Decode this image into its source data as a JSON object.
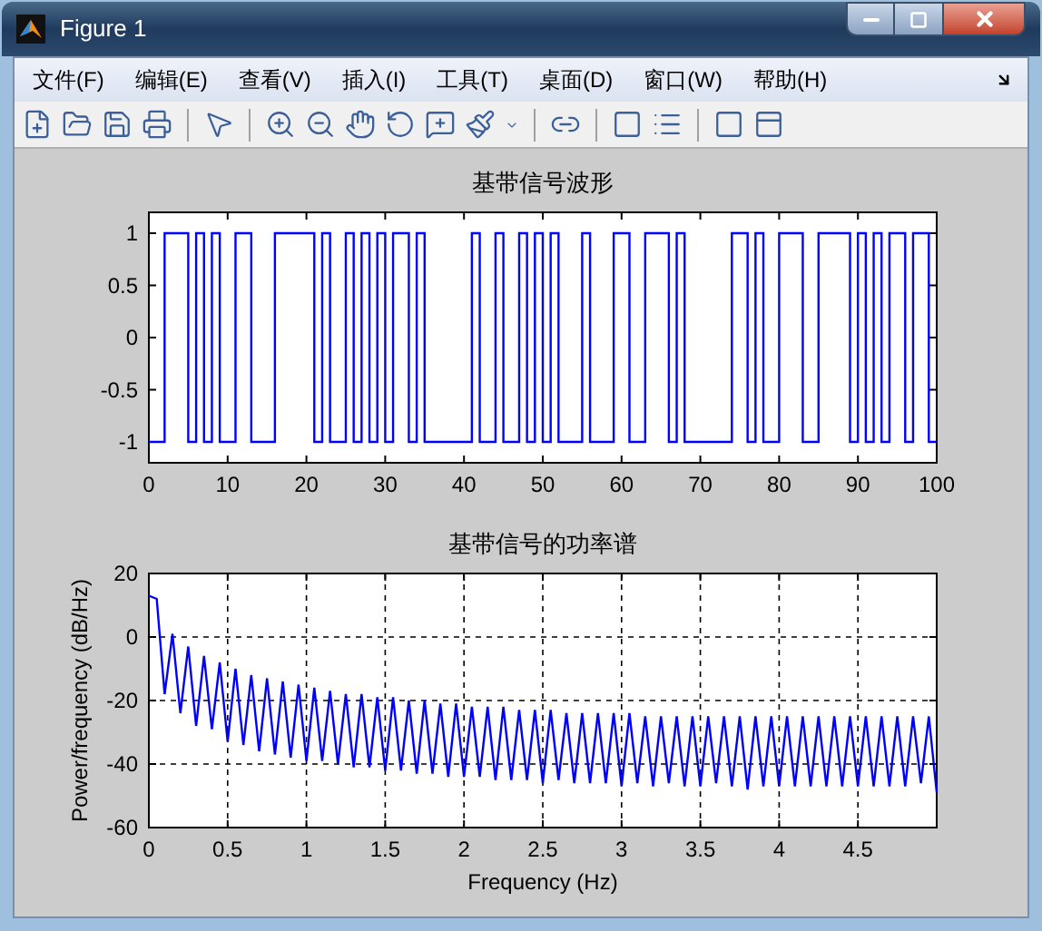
{
  "window": {
    "title": "Figure 1"
  },
  "menu": [
    "文件(F)",
    "编辑(E)",
    "查看(V)",
    "插入(I)",
    "工具(T)",
    "桌面(D)",
    "窗口(W)",
    "帮助(H)"
  ],
  "plots": [
    {
      "title": "基带信号波形",
      "chart_data": {
        "type": "line",
        "xlim": [
          0,
          100
        ],
        "ylim": [
          -1.2,
          1.2
        ],
        "xticks": [
          0,
          10,
          20,
          30,
          40,
          50,
          60,
          70,
          80,
          90,
          100
        ],
        "yticks": [
          -1,
          -0.5,
          0,
          0.5,
          1
        ],
        "x": [
          0,
          2,
          2,
          5,
          5,
          6,
          6,
          7,
          7,
          8,
          8,
          9,
          9,
          11,
          11,
          13,
          13,
          16,
          16,
          21,
          21,
          22,
          22,
          23,
          23,
          25,
          25,
          26,
          26,
          27,
          27,
          28,
          28,
          29,
          29,
          30,
          30,
          31,
          31,
          33,
          33,
          34,
          34,
          35,
          35,
          41,
          41,
          42,
          42,
          44,
          44,
          45,
          45,
          47,
          47,
          48,
          48,
          49,
          49,
          50,
          50,
          51,
          51,
          52,
          52,
          55,
          55,
          56,
          56,
          59,
          59,
          61,
          61,
          63,
          63,
          66,
          66,
          67,
          67,
          68,
          68,
          74,
          74,
          76,
          76,
          77,
          77,
          78,
          78,
          80,
          80,
          83,
          83,
          85,
          85,
          89,
          89,
          90,
          90,
          91,
          91,
          92,
          92,
          93,
          93,
          94,
          94,
          96,
          96,
          97,
          97,
          99,
          99,
          100
        ],
        "series": [
          {
            "color": "#0000ff",
            "values": [
              -1,
              -1,
              1,
              1,
              -1,
              -1,
              1,
              1,
              -1,
              -1,
              1,
              1,
              -1,
              -1,
              1,
              1,
              -1,
              -1,
              1,
              1,
              -1,
              -1,
              1,
              1,
              -1,
              -1,
              1,
              1,
              -1,
              -1,
              1,
              1,
              -1,
              -1,
              1,
              1,
              -1,
              -1,
              1,
              1,
              -1,
              -1,
              1,
              1,
              -1,
              -1,
              1,
              1,
              -1,
              -1,
              1,
              1,
              -1,
              -1,
              1,
              1,
              -1,
              -1,
              1,
              1,
              -1,
              -1,
              1,
              1,
              -1,
              -1,
              1,
              1,
              -1,
              -1,
              1,
              1,
              -1,
              -1,
              1,
              1,
              -1,
              -1,
              1,
              1,
              -1,
              -1,
              1,
              1,
              -1,
              -1,
              1,
              1,
              -1,
              -1,
              1,
              1,
              -1,
              -1,
              1,
              1,
              -1,
              -1,
              1,
              1,
              -1,
              -1,
              1,
              1,
              -1,
              -1,
              1,
              1,
              -1,
              -1,
              1,
              1,
              -1,
              -1
            ]
          }
        ]
      }
    },
    {
      "title": "基带信号的功率谱",
      "chart_data": {
        "type": "line",
        "grid": true,
        "xlabel": "Frequency (Hz)",
        "ylabel": "Power/frequency (dB/Hz)",
        "xlim": [
          0,
          5
        ],
        "ylim": [
          -60,
          20
        ],
        "xticks": [
          0,
          0.5,
          1,
          1.5,
          2,
          2.5,
          3,
          3.5,
          4,
          4.5
        ],
        "yticks": [
          -60,
          -40,
          -20,
          0,
          20
        ],
        "x": [
          0,
          0.05,
          0.1,
          0.15,
          0.2,
          0.25,
          0.3,
          0.35,
          0.4,
          0.45,
          0.5,
          0.55,
          0.6,
          0.65,
          0.7,
          0.75,
          0.8,
          0.85,
          0.9,
          0.95,
          1,
          1.05,
          1.1,
          1.15,
          1.2,
          1.25,
          1.3,
          1.35,
          1.4,
          1.45,
          1.5,
          1.55,
          1.6,
          1.65,
          1.7,
          1.75,
          1.8,
          1.85,
          1.9,
          1.95,
          2,
          2.05,
          2.1,
          2.15,
          2.2,
          2.25,
          2.3,
          2.35,
          2.4,
          2.45,
          2.5,
          2.55,
          2.6,
          2.65,
          2.7,
          2.75,
          2.8,
          2.85,
          2.9,
          2.95,
          3,
          3.05,
          3.1,
          3.15,
          3.2,
          3.25,
          3.3,
          3.35,
          3.4,
          3.45,
          3.5,
          3.55,
          3.6,
          3.65,
          3.7,
          3.75,
          3.8,
          3.85,
          3.9,
          3.95,
          4,
          4.05,
          4.1,
          4.15,
          4.2,
          4.25,
          4.3,
          4.35,
          4.4,
          4.45,
          4.5,
          4.55,
          4.6,
          4.65,
          4.7,
          4.75,
          4.8,
          4.85,
          4.9,
          4.95,
          5
        ],
        "series": [
          {
            "color": "#0000ff",
            "values": [
              13,
              12,
              -18,
              1,
              -24,
              -3,
              -28,
              -6,
              -29,
              -8,
              -33,
              -10,
              -34,
              -12,
              -36,
              -13,
              -37,
              -14,
              -38,
              -15,
              -39,
              -16,
              -39,
              -17,
              -40,
              -18,
              -41,
              -18,
              -41,
              -19,
              -42,
              -19,
              -42,
              -20,
              -43,
              -20,
              -43,
              -21,
              -44,
              -21,
              -44,
              -22,
              -44,
              -22,
              -45,
              -22,
              -45,
              -23,
              -45,
              -23,
              -46,
              -23,
              -45,
              -24,
              -46,
              -24,
              -46,
              -24,
              -46,
              -24,
              -47,
              -24,
              -46,
              -25,
              -47,
              -25,
              -46,
              -25,
              -47,
              -25,
              -47,
              -25,
              -46,
              -25,
              -47,
              -25,
              -48,
              -25,
              -47,
              -25,
              -47,
              -25,
              -47,
              -25,
              -47,
              -25,
              -47,
              -25,
              -47,
              -25,
              -47,
              -25,
              -47,
              -25,
              -47,
              -25,
              -47,
              -25,
              -46,
              -25,
              -49
            ]
          }
        ]
      }
    }
  ]
}
